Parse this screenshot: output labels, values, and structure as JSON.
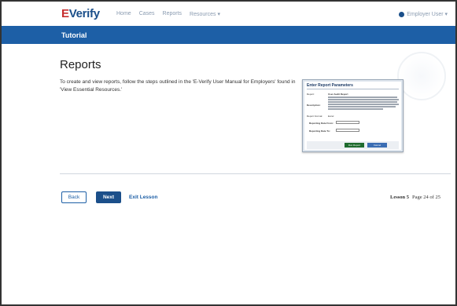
{
  "navbar": {
    "logo": "E-Verify",
    "logo_prefix": "E",
    "logo_rest": "Verify",
    "links": [
      "Home",
      "Cases",
      "Reports",
      "Resources ▾"
    ],
    "user_label": "Employer User ▾",
    "user_icon": "user-circle-icon"
  },
  "banner": {
    "title": "Tutorial"
  },
  "main": {
    "title": "Reports",
    "description": "To create and view reports, follow the steps outlined in the 'E-Verify User Manual for Employers' found in 'View Essential Resources.'"
  },
  "screenshot_modal": {
    "title": "Enter Report Parameters",
    "report_label": "Report:",
    "report_value": "User Audit Report",
    "description_label": "Description:",
    "format_label": "Report Format:",
    "format_options": [
      "Excel",
      "Excel"
    ],
    "from_label": "Reporting Date From:",
    "to_label": "Reporting Date To:",
    "run_button": "Run Report",
    "cancel_button": "Cancel"
  },
  "footer": {
    "back_label": "Back",
    "next_label": "Next",
    "exit_label": "Exit Lesson",
    "lesson_label": "Lesson 5",
    "page_label": "Page 24 of 25"
  },
  "colors": {
    "brand_blue": "#1d5fa6",
    "navy": "#1b4f8a",
    "logo_red": "#c62d2d",
    "run_green": "#1e6b2e"
  }
}
